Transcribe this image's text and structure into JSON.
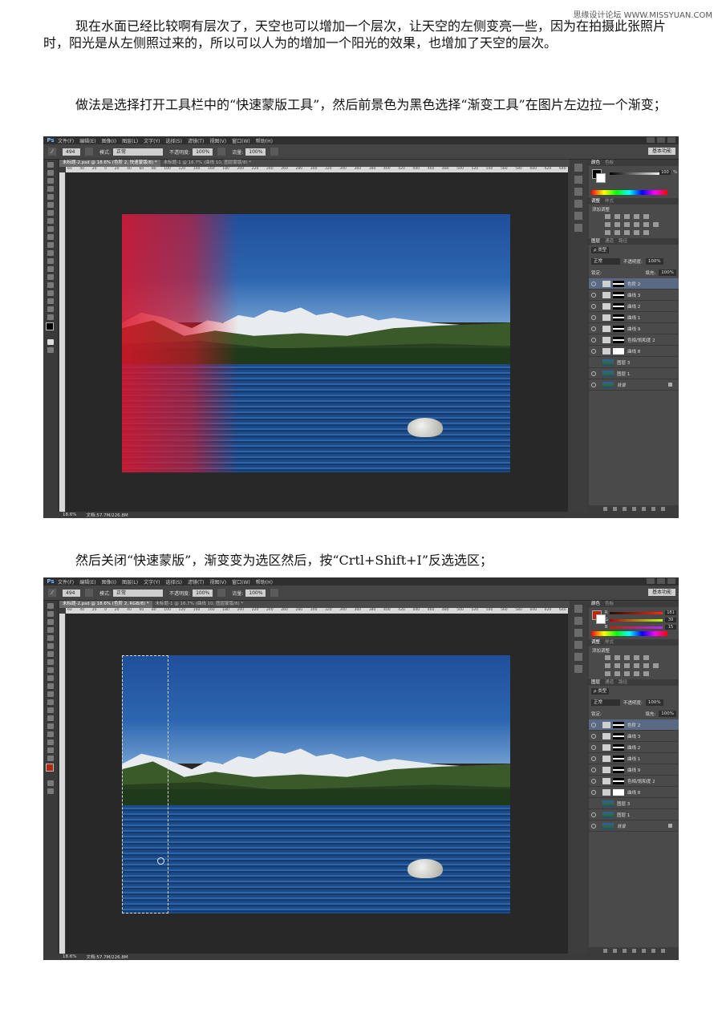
{
  "watermark": "思缘设计论坛 WWW.MISSYUAN.COM",
  "paragraphs": {
    "p1": "现在水面已经比较啊有层次了，天空也可以增加一个层次，让天空的左侧变亮一些，因为在拍摄此张照片时，阳光是从左侧照过来的，所以可以人为的增加一个阳光的效果，也增加了天空的层次。",
    "p2": "做法是选择打开工具栏中的“快速蒙版工具”，然后前景色为黑色选择“渐变工具”在图片左边拉一个渐变；",
    "p3": "然后关闭“快速蒙版”，渐变变为选区然后，按“Crtl+Shift+I”反选选区；"
  },
  "app": {
    "logo": "Ps",
    "menu": [
      "文件(F)",
      "编辑(E)",
      "图像(I)",
      "图层(L)",
      "文字(Y)",
      "选择(S)",
      "滤镜(T)",
      "视图(V)",
      "窗口(W)",
      "帮助(H)"
    ],
    "options": {
      "size": "494",
      "mode_label": "模式:",
      "mode_value": "正常",
      "opacity_label": "不透明度:",
      "opacity_value": "100%",
      "flow_label": "流量:",
      "flow_value": "100%"
    },
    "workspace": "基本功能",
    "ruler_ticks": [
      "60",
      "40",
      "20",
      "0",
      "20",
      "40",
      "60",
      "80",
      "100",
      "120",
      "140",
      "160",
      "180",
      "200",
      "220",
      "240",
      "260",
      "280",
      "300",
      "320",
      "340",
      "360",
      "380",
      "400",
      "420",
      "440",
      "460",
      "480",
      "500",
      "520",
      "540",
      "560",
      "580",
      "600",
      "620",
      "640"
    ],
    "color_tabs": [
      "颜色",
      "色板"
    ],
    "adjust_tabs": [
      "调整",
      "样式"
    ],
    "adjust_title": "添加调整",
    "layer_tabs": [
      "图层",
      "通道",
      "路径"
    ],
    "kind_label": "ρ 类型",
    "blend_mode": "正常",
    "opacity_label": "不透明度:",
    "opacity_value": "100%",
    "lock_label": "锁定:",
    "fill_label": "填充:",
    "fill_value": "100%",
    "layers": [
      "色阶 2",
      "曲线 3",
      "曲线 2",
      "曲线 1",
      "曲线 9",
      "色相/饱和度 2",
      "曲线 8",
      "图层 3",
      "图层 1",
      "背景"
    ],
    "status_zoom": "18.6%",
    "status_doc": "文档:57.7M/226.8M"
  },
  "shot1": {
    "tabs": [
      "未标题-2.psd @ 18.6% (色阶 2, 快速蒙版/8) *",
      "未标题-1 @ 16.7% (曲线 10, 图层蒙版/8) *"
    ],
    "swatch_value": "100",
    "swatch_unit": "%"
  },
  "shot2": {
    "tabs": [
      "未标题-2.psd @ 18.6% (色阶 2, RGB/8) *",
      "未标题-1 @ 16.7% (曲线 10, 图层蒙版/8) *"
    ],
    "r_label": "R",
    "r_value": "181",
    "g_label": "G",
    "g_value": "39",
    "b_label": "B",
    "b_value": "15"
  },
  "colors": {
    "fg_black": "#000000",
    "fg_rust": "#b5270f",
    "quickmask": "#dc1428"
  }
}
